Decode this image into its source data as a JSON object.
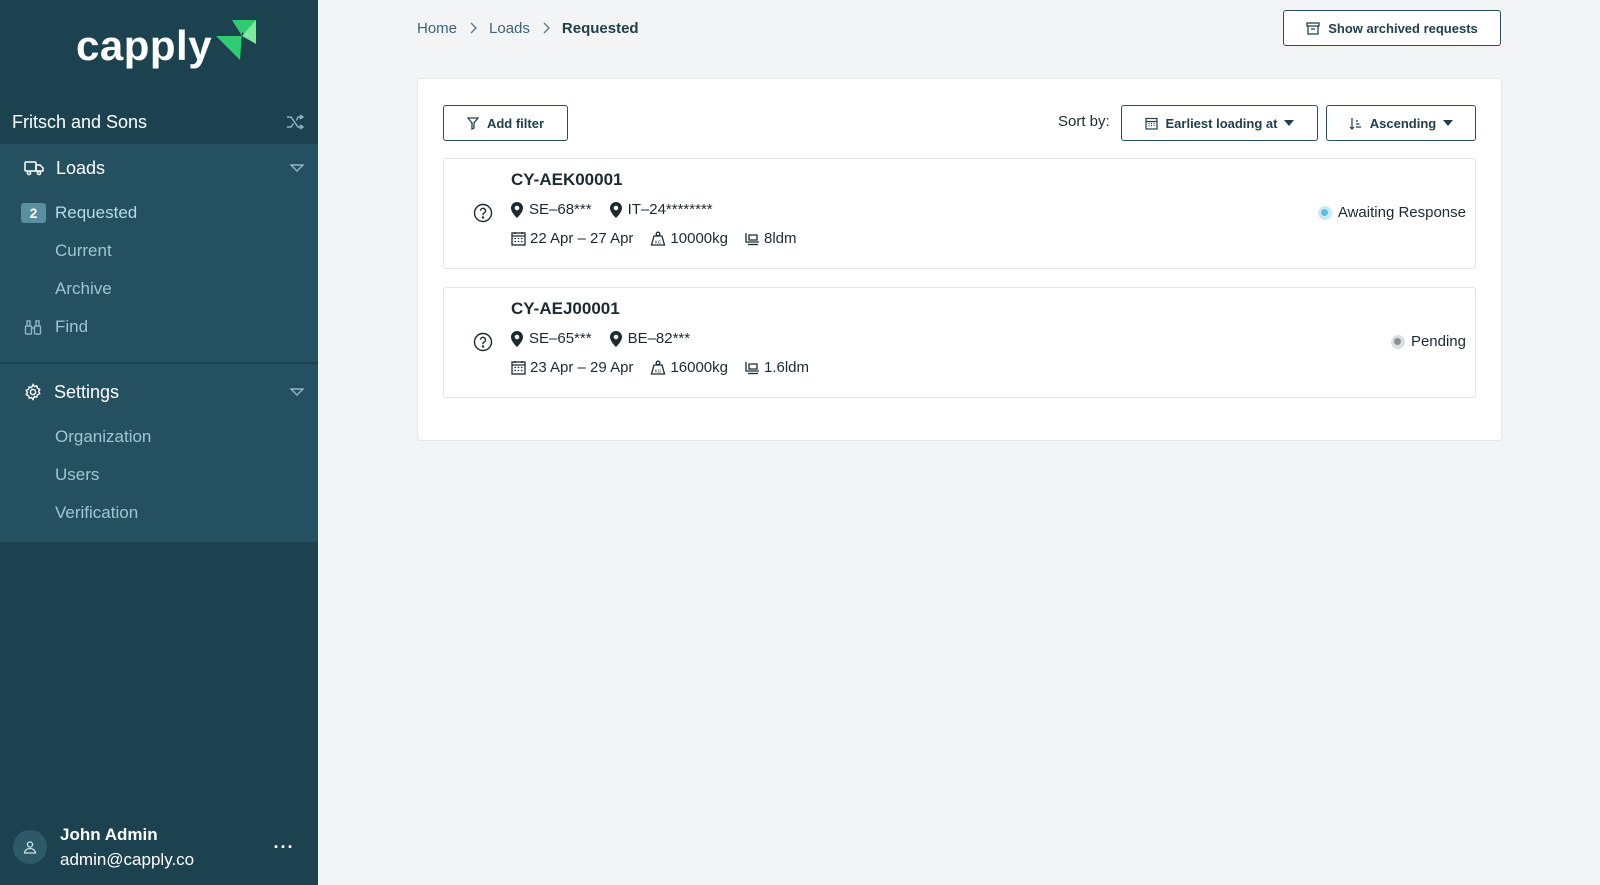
{
  "brand": {
    "name": "capply",
    "accent": "#2ecc71"
  },
  "sidebar": {
    "organization": "Fritsch and Sons",
    "loads": {
      "label": "Loads",
      "items": [
        {
          "label": "Requested",
          "badge": "2",
          "active": true
        },
        {
          "label": "Current"
        },
        {
          "label": "Archive"
        },
        {
          "label": "Find"
        }
      ]
    },
    "settings": {
      "label": "Settings",
      "items": [
        {
          "label": "Organization"
        },
        {
          "label": "Users"
        },
        {
          "label": "Verification"
        }
      ]
    },
    "user": {
      "name": "John Admin",
      "email": "admin@capply.co",
      "more": "···"
    }
  },
  "breadcrumb": [
    "Home",
    "Loads",
    "Requested"
  ],
  "archived_button": "Show archived requests",
  "toolbar": {
    "add_filter": "Add filter",
    "sort_label": "Sort by:",
    "sort_field": "Earliest loading at",
    "sort_direction": "Ascending"
  },
  "loads": [
    {
      "ref": "CY-AEK00001",
      "origin": "SE–68***",
      "destination": "IT–24********",
      "dates": "22 Apr – 27 Apr",
      "weight": "10000kg",
      "ldm": "8ldm",
      "status": "Awaiting Response",
      "status_color": "#5bbde8",
      "status_ring": "#cde9f6"
    },
    {
      "ref": "CY-AEJ00001",
      "origin": "SE–65***",
      "destination": "BE–82***",
      "dates": "23 Apr – 29 Apr",
      "weight": "16000kg",
      "ldm": "1.6ldm",
      "status": "Pending",
      "status_color": "#8a8f92",
      "status_ring": "#dcdfe1"
    }
  ]
}
